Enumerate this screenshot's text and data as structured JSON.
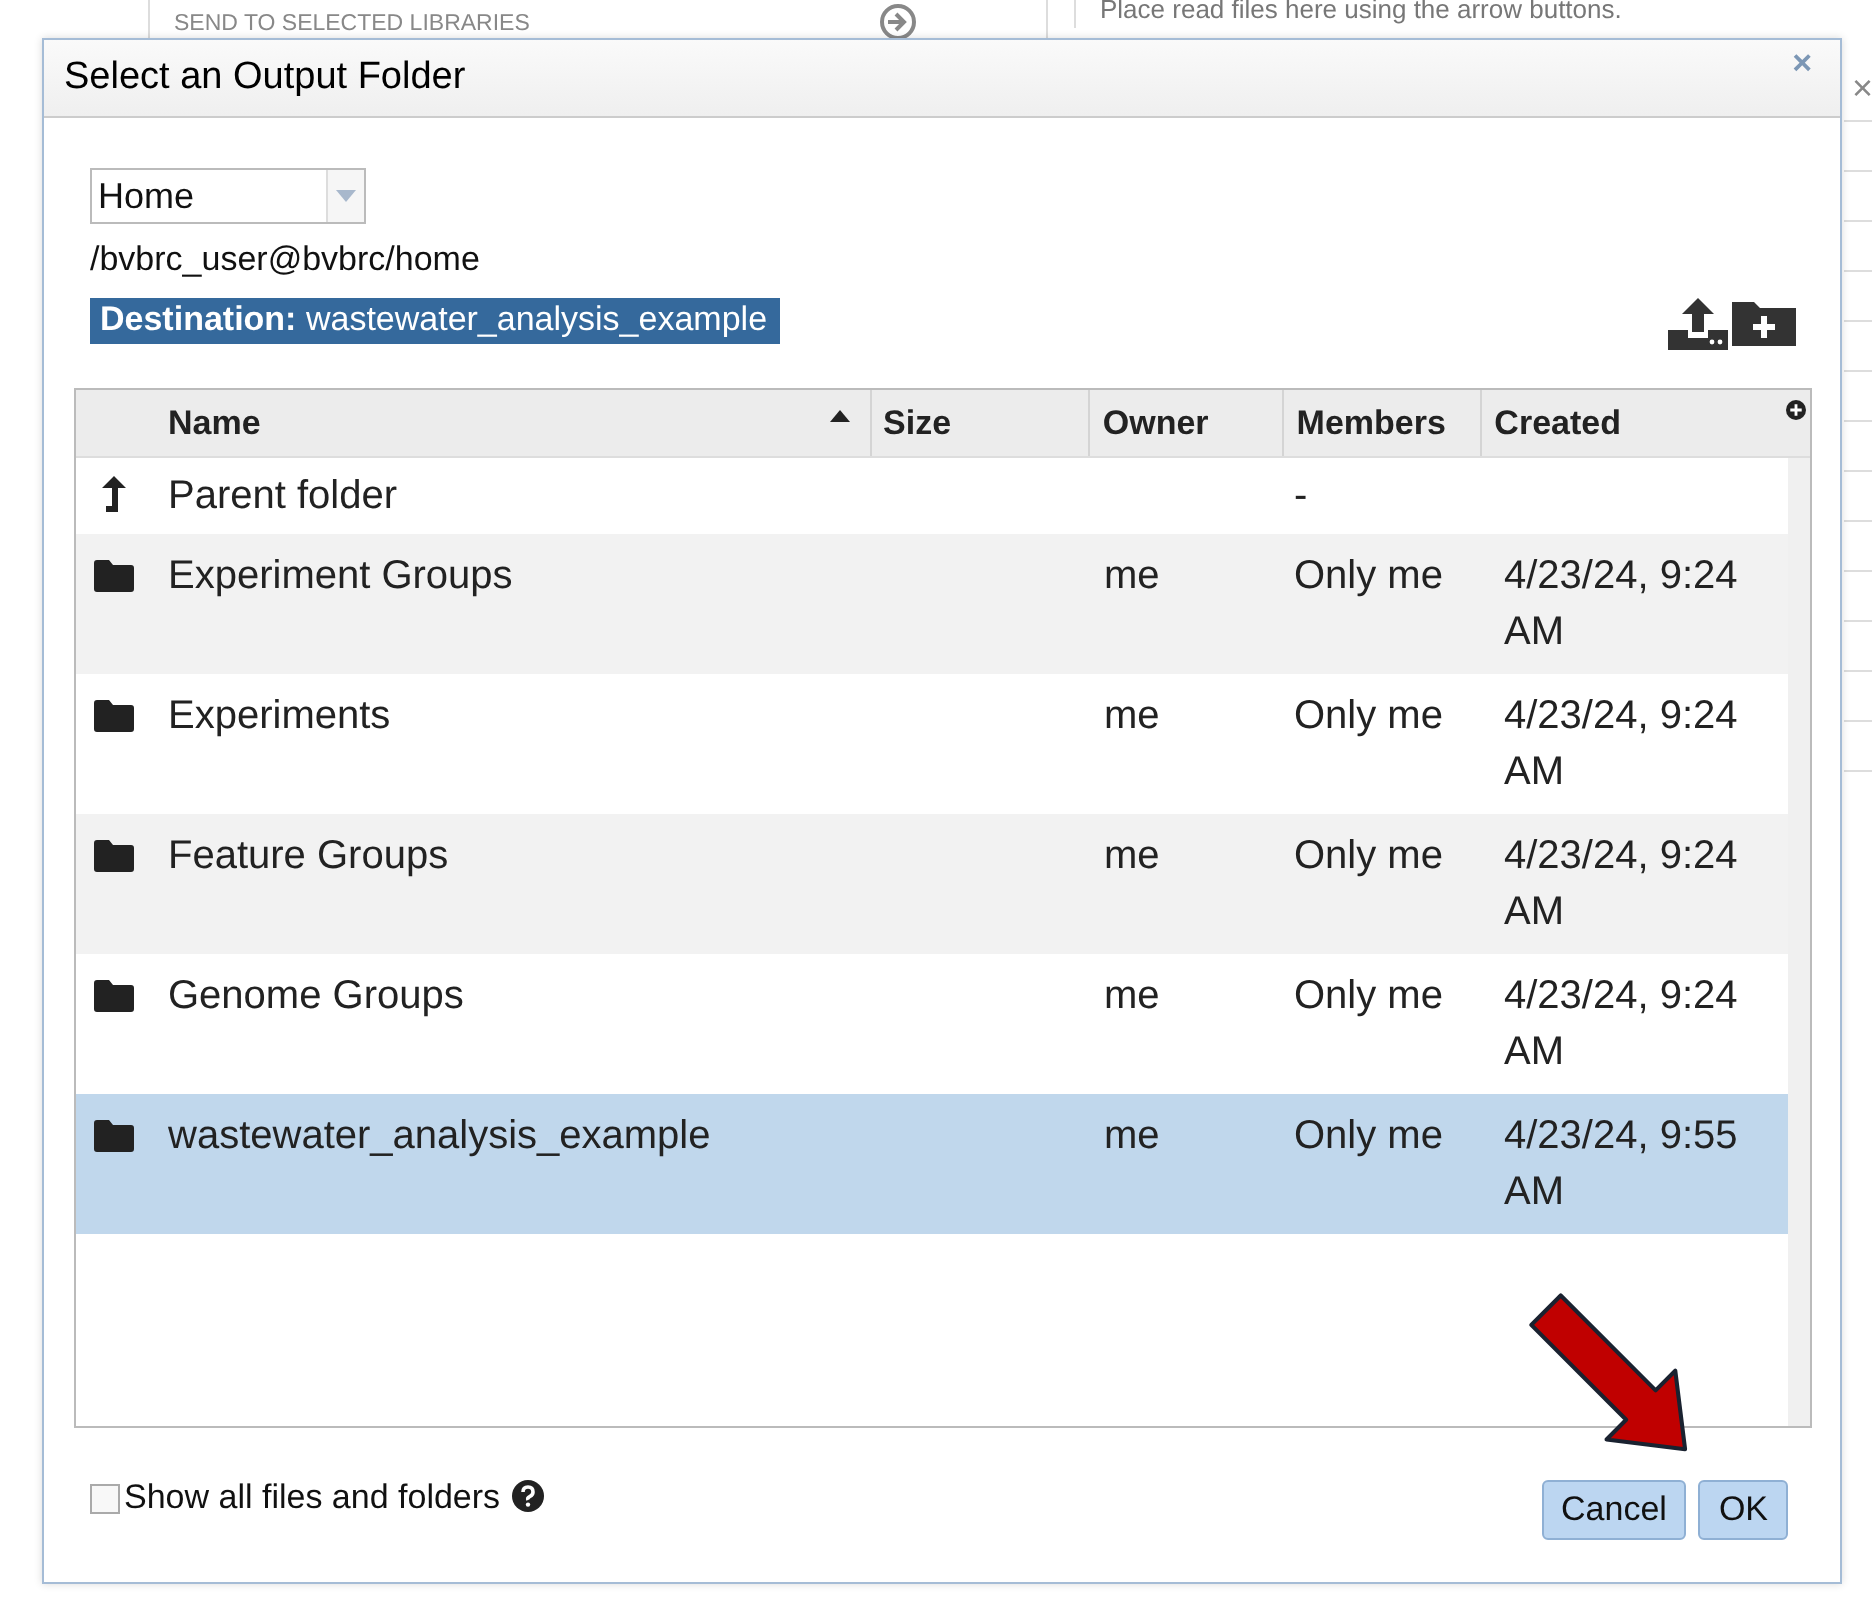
{
  "background": {
    "section_label": "SEND TO SELECTED LIBRARIES",
    "hint": "Place read files here using the arrow buttons.",
    "close": "×"
  },
  "dialog": {
    "title": "Select an Output Folder",
    "close": "×",
    "location": "Home",
    "path": "/bvbrc_user@bvbrc/home",
    "destination": "**Destination:** wastewater_analysis_example",
    "columns": [
      {
        "label": "Name",
        "sorted": true
      },
      {
        "label": "Size",
        "sorted": false
      },
      {
        "label": "Owner",
        "sorted": false
      },
      {
        "label": "Members",
        "sorted": false
      },
      {
        "label": "Created",
        "sorted": false
      }
    ],
    "rows": [
      {
        "kind": "parent",
        "name": "Parent folder",
        "owner": "",
        "members": "-",
        "created": "",
        "selected": false
      },
      {
        "kind": "folder",
        "name": "Experiment Groups",
        "owner": "me",
        "members": "Only me",
        "created": "4/23/24, 9:24 AM",
        "selected": false
      },
      {
        "kind": "folder",
        "name": "Experiments",
        "owner": "me",
        "members": "Only me",
        "created": "4/23/24, 9:24 AM",
        "selected": false
      },
      {
        "kind": "folder",
        "name": "Feature Groups",
        "owner": "me",
        "members": "Only me",
        "created": "4/23/24, 9:24 AM",
        "selected": false
      },
      {
        "kind": "folder",
        "name": "Genome Groups",
        "owner": "me",
        "members": "Only me",
        "created": "4/23/24, 9:24 AM",
        "selected": false
      },
      {
        "kind": "folder",
        "name": "wastewater_analysis_example",
        "owner": "me",
        "members": "Only me",
        "created": "4/23/24, 9:55 AM",
        "selected": true
      }
    ],
    "show_all": {
      "label": "Show all files and folders",
      "checked": false
    },
    "buttons": [
      {
        "label": "Cancel"
      },
      {
        "label": "OK"
      }
    ]
  }
}
